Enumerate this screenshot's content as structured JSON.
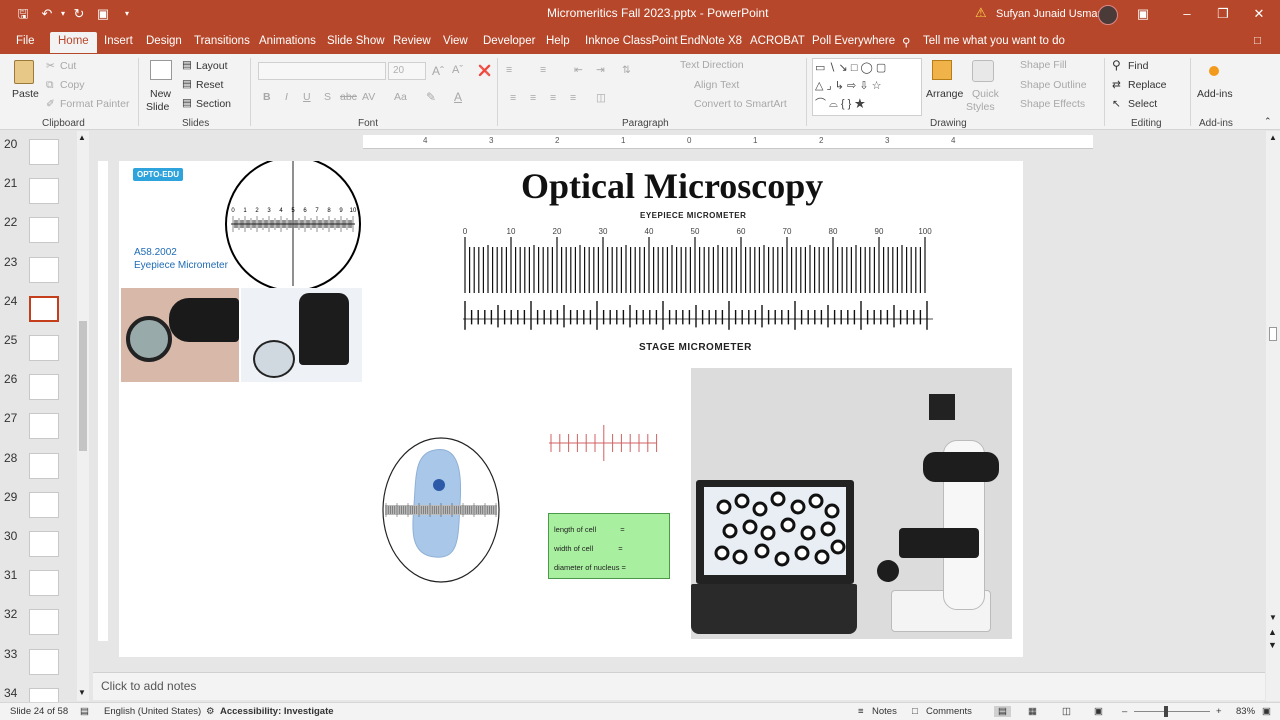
{
  "titlebar": {
    "filename": "Micromeritics Fall 2023.pptx",
    "separator": "-",
    "app": "PowerPoint",
    "user": "Sufyan Junaid Usmani"
  },
  "menu": {
    "file": "File",
    "tabs": [
      "Home",
      "Insert",
      "Design",
      "Transitions",
      "Animations",
      "Slide Show",
      "Review",
      "View",
      "Developer",
      "Help",
      "Inknoe ClassPoint",
      "EndNote X8",
      "ACROBAT",
      "Poll Everywhere"
    ],
    "tell_me": "Tell me what you want to do"
  },
  "ribbon": {
    "clipboard": {
      "paste": "Paste",
      "cut": "Cut",
      "copy": "Copy",
      "format_painter": "Format Painter",
      "label": "Clipboard"
    },
    "slides": {
      "new_slide_1": "New",
      "new_slide_2": "Slide",
      "layout": "Layout",
      "reset": "Reset",
      "section": "Section",
      "label": "Slides"
    },
    "font": {
      "size": "20",
      "bold": "B",
      "italic": "I",
      "underline": "U",
      "shadow": "S",
      "strike": "abc",
      "spacing": "AV",
      "case": "Aa",
      "label": "Font"
    },
    "paragraph": {
      "text_direction": "Text Direction",
      "align_text": "Align Text",
      "convert_smartart": "Convert to SmartArt",
      "label": "Paragraph"
    },
    "drawing": {
      "arrange": "Arrange",
      "quick_styles_1": "Quick",
      "quick_styles_2": "Styles",
      "shape_fill": "Shape Fill",
      "shape_outline": "Shape Outline",
      "shape_effects": "Shape Effects",
      "label": "Drawing"
    },
    "editing": {
      "find": "Find",
      "replace": "Replace",
      "select": "Select",
      "label": "Editing"
    },
    "addins": {
      "addins": "Add-ins",
      "label": "Add-ins"
    }
  },
  "ruler": {
    "marks": [
      "4",
      "3",
      "2",
      "1",
      "0",
      "1",
      "2",
      "3",
      "4"
    ]
  },
  "thumbnails": [
    {
      "num": "20"
    },
    {
      "num": "21"
    },
    {
      "num": "22"
    },
    {
      "num": "23"
    },
    {
      "num": "24",
      "selected": true
    },
    {
      "num": "25"
    },
    {
      "num": "26"
    },
    {
      "num": "27"
    },
    {
      "num": "28"
    },
    {
      "num": "29"
    },
    {
      "num": "30"
    },
    {
      "num": "31"
    },
    {
      "num": "32"
    },
    {
      "num": "33"
    },
    {
      "num": "34"
    }
  ],
  "slide": {
    "title": "Optical Microscopy",
    "opto_badge": "OPTO-EDU",
    "model": "A58.2002",
    "model_desc": "Eyepiece Micrometer",
    "reticle_numbers": [
      "0",
      "1",
      "2",
      "3",
      "4",
      "5",
      "6",
      "7",
      "8",
      "9",
      "10"
    ],
    "eyepiece_label": "EYEPIECE MICROMETER",
    "stage_label": "STAGE MICROMETER",
    "scale_numbers": [
      "0",
      "10",
      "20",
      "30",
      "40",
      "50",
      "60",
      "70",
      "80",
      "90",
      "100"
    ],
    "cell_box": [
      "length of cell",
      "width of cell",
      "diameter of nucleus"
    ],
    "cell_box_eq": "=",
    "cell_box_color": "#a8f0a0"
  },
  "notes": {
    "placeholder": "Click to add notes"
  },
  "status": {
    "slide_of": "Slide 24 of 58",
    "language": "English (United States)",
    "accessibility": "Accessibility: Investigate",
    "notes": "Notes",
    "comments": "Comments",
    "zoom": "83%"
  },
  "colors": {
    "accent": "#b7472a",
    "selected_thumb": "#c43e1c",
    "badge": "#2ea3dc",
    "link_blue": "#1f6bb5"
  }
}
